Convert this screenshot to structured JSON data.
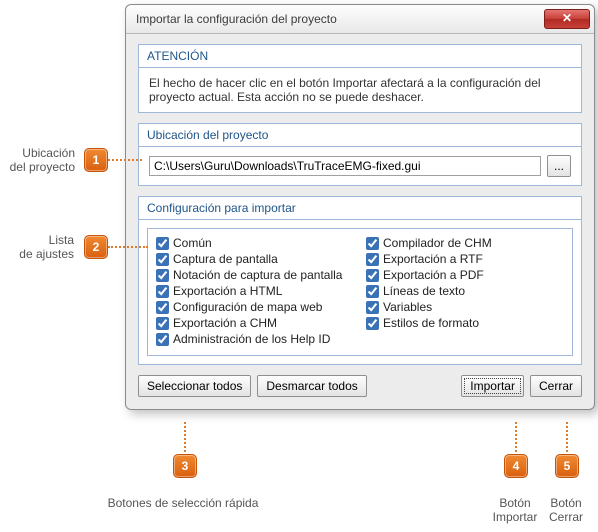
{
  "dialog": {
    "title": "Importar la configuración del proyecto",
    "close_glyph": "✕",
    "attention_head": "ATENCIÓN",
    "attention_body": "El hecho de hacer clic en el botón Importar afectará a la configuración del proyecto actual. Esta acción no se puede deshacer.",
    "location_head": "Ubicación del proyecto",
    "location_value": "C:\\Users\\Guru\\Downloads\\TruTraceEMG-fixed.gui",
    "browse_label": "...",
    "settings_head": "Configuración para importar",
    "checks": [
      {
        "label": "Común",
        "checked": true
      },
      {
        "label": "Captura de pantalla",
        "checked": true
      },
      {
        "label": "Notación de captura de pantalla",
        "checked": true
      },
      {
        "label": "Exportación a HTML",
        "checked": true
      },
      {
        "label": "Configuración de mapa web",
        "checked": true
      },
      {
        "label": "Exportación a CHM",
        "checked": true
      },
      {
        "label": "Administración de los Help ID",
        "checked": true
      },
      {
        "label": "Compilador de CHM",
        "checked": true
      },
      {
        "label": "Exportación a RTF",
        "checked": true
      },
      {
        "label": "Exportación a PDF",
        "checked": true
      },
      {
        "label": "Líneas de texto",
        "checked": true
      },
      {
        "label": "Variables",
        "checked": true
      },
      {
        "label": "Estilos de formato",
        "checked": true
      }
    ],
    "select_all": "Seleccionar todos",
    "deselect_all": "Desmarcar todos",
    "import": "Importar",
    "close": "Cerrar"
  },
  "annotations": {
    "m1": "1",
    "m2": "2",
    "m3": "3",
    "m4": "4",
    "m5": "5",
    "label1a": "Ubicación",
    "label1b": "del proyecto",
    "label2a": "Lista",
    "label2b": "de ajustes",
    "label3": "Botones de selección rápida",
    "label4a": "Botón",
    "label4b": "Importar",
    "label5a": "Botón",
    "label5b": "Cerrar"
  },
  "colors": {
    "accent_blue": "#20558a",
    "border_blue": "#9fb8d9",
    "marker_orange": "#e07b2a"
  }
}
